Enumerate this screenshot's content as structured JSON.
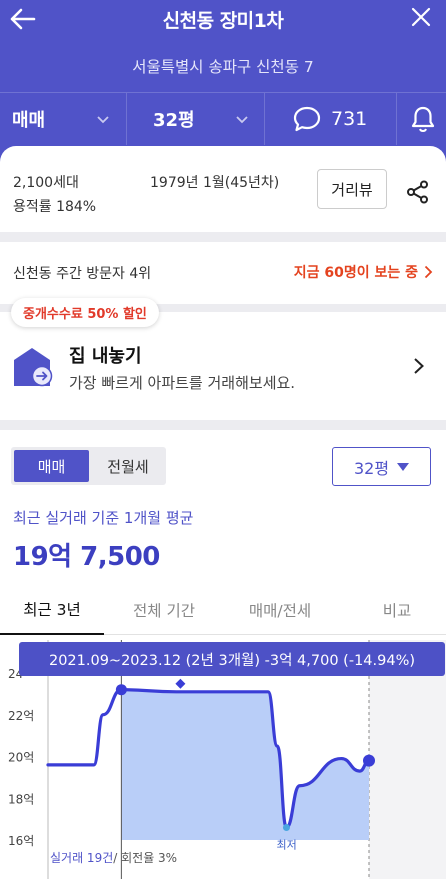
{
  "header": {
    "title": "신천동 장미1차",
    "address": "서울특별시 송파구 신천동 7",
    "trade_type": "매매",
    "area": "32평",
    "comment_count": "731"
  },
  "info": {
    "households": "2,100세대",
    "far": "용적률 184%",
    "built": "1979년 1월(45년차)",
    "street_view_button": "거리뷰"
  },
  "visit": {
    "rank_text": "신천동 주간 방문자 4위",
    "live_viewers": "지금 60명이 보는 중"
  },
  "sell_banner": {
    "badge": "중개수수료 50% 할인",
    "title": "집 내놓기",
    "subtitle": "가장 빠르게 아파트를 거래해보세요."
  },
  "market": {
    "seg_sale": "매매",
    "seg_rent": "전월세",
    "area_select": "32평",
    "avg_label": "최근 실거래 기준 1개월 평균",
    "avg_price": "19억 7,500",
    "tabs": [
      "최근 3년",
      "전체 기간",
      "매매/전세",
      "비교"
    ],
    "tooltip": "2021.09~2023.12 (2년 3개월)  -3억 4,700 (-14.94%)",
    "trade_count": "실거래 19건",
    "turnover": "/ 회전율 3%",
    "min_label": "최저"
  },
  "colors": {
    "brand": "#5053c8",
    "accent_red": "#e4431f",
    "line": "#3a3dd6",
    "fill": "#b9cef8"
  },
  "chart_data": {
    "type": "area",
    "ylabel": "",
    "yticks": [
      "16억",
      "18억",
      "20억",
      "22억",
      "24"
    ],
    "ylim": [
      16,
      24
    ],
    "x_range": [
      "2021.01",
      "2024.01"
    ],
    "series": [
      {
        "values": [
          {
            "x": "2021.01",
            "y": 19.6
          },
          {
            "x": "2021.06",
            "y": 19.6
          },
          {
            "x": "2021.07",
            "y": 22.0
          },
          {
            "x": "2021.09",
            "y": 23.2
          },
          {
            "x": "2022.03",
            "y": 23.1
          },
          {
            "x": "2022.09",
            "y": 23.1
          },
          {
            "x": "2023.01",
            "y": 23.1
          },
          {
            "x": "2023.04",
            "y": 18.2
          },
          {
            "x": "2023.09",
            "y": 19.9
          },
          {
            "x": "2023.11",
            "y": 19.3
          },
          {
            "x": "2023.12",
            "y": 19.8
          }
        ]
      }
    ],
    "highlight_range": [
      "2021.09",
      "2023.12"
    ],
    "min_point": {
      "x": "2023.03",
      "y": 16.6
    }
  }
}
